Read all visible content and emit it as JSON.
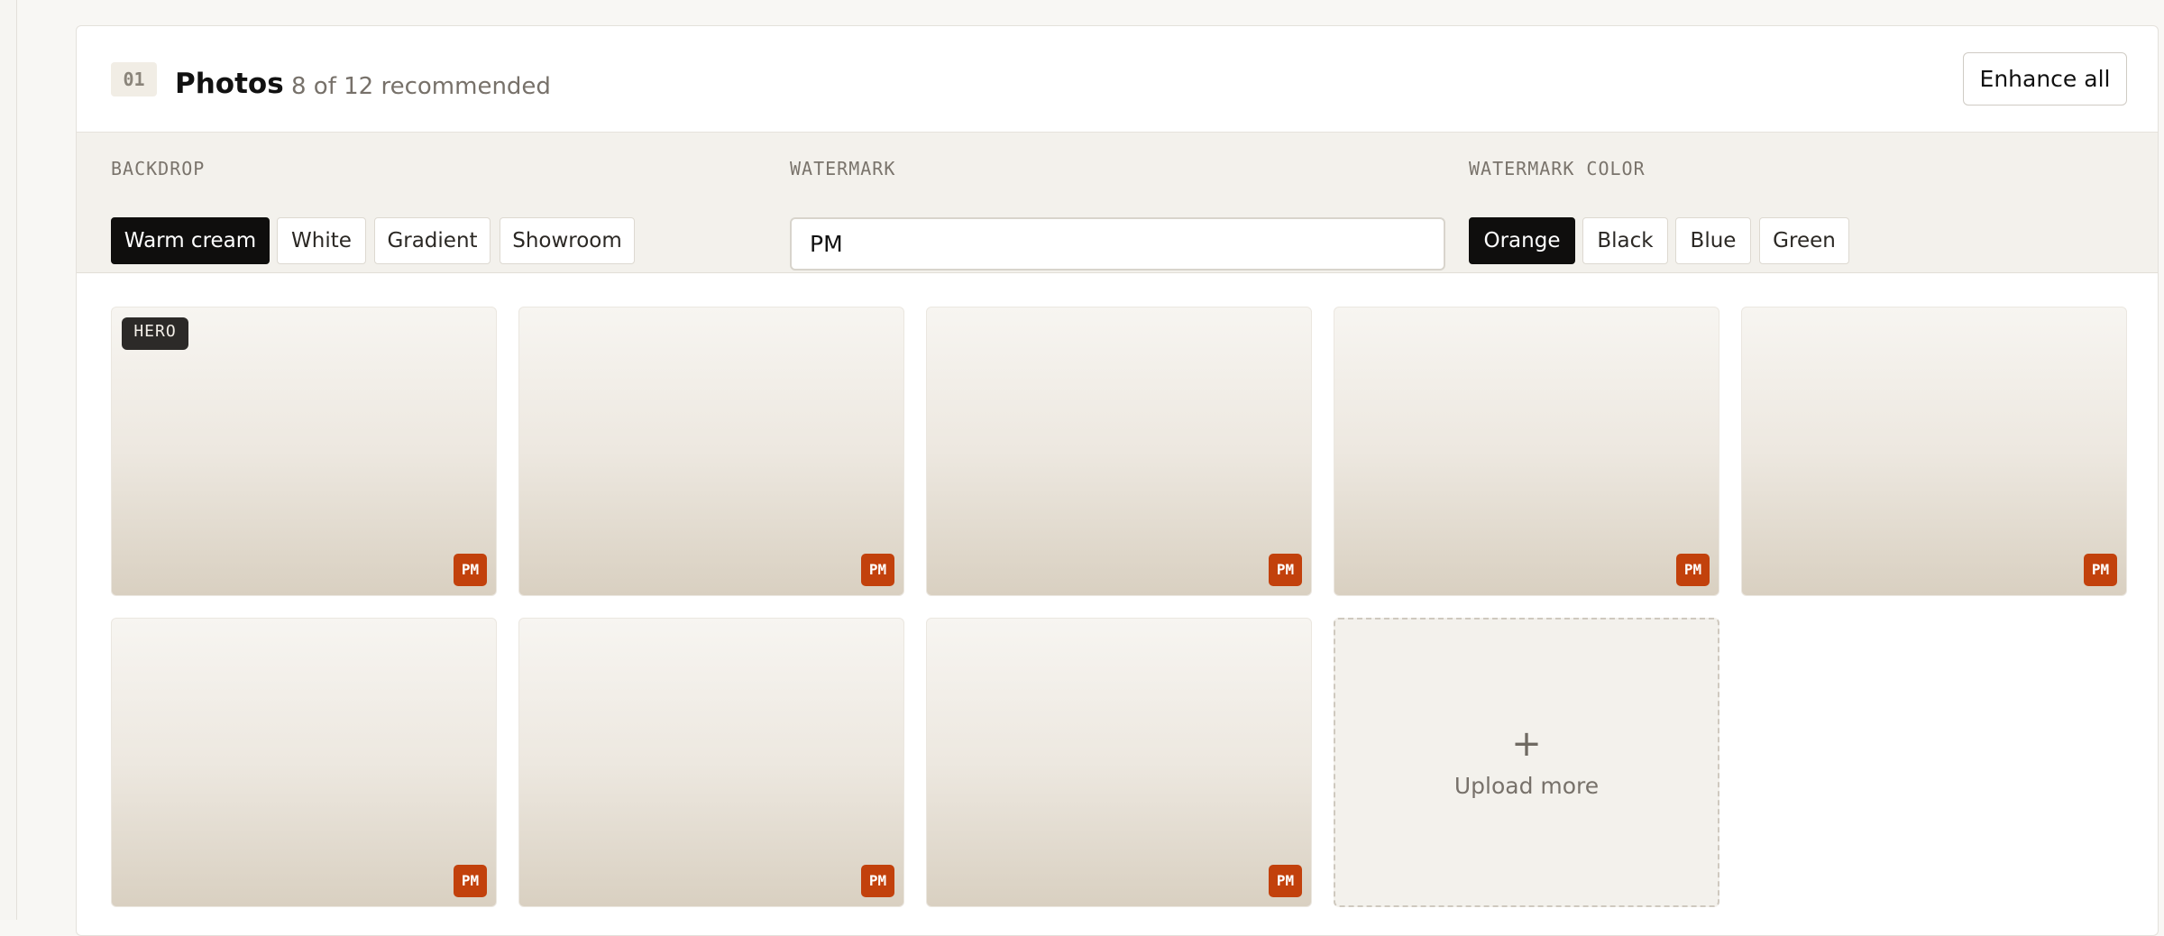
{
  "panel": {
    "step": "01",
    "title": "Photos",
    "subtitle": "8 of 12 recommended",
    "enhance_label": "Enhance all"
  },
  "controls": {
    "backdrop": {
      "label": "BACKDROP",
      "options": [
        "Warm cream",
        "White",
        "Gradient",
        "Showroom"
      ],
      "selected": "Warm cream"
    },
    "watermark": {
      "label": "WATERMARK",
      "value": "PM"
    },
    "watermark_color": {
      "label": "WATERMARK COLOR",
      "options": [
        "Orange",
        "Black",
        "Blue",
        "Green"
      ],
      "selected": "Orange",
      "selected_hex": "#c2410c"
    }
  },
  "photos": {
    "hero_badge": "HERO",
    "watermark_text": "PM",
    "count": 8
  },
  "upload": {
    "icon": "plus-icon",
    "plus": "+",
    "label": "Upload more"
  }
}
